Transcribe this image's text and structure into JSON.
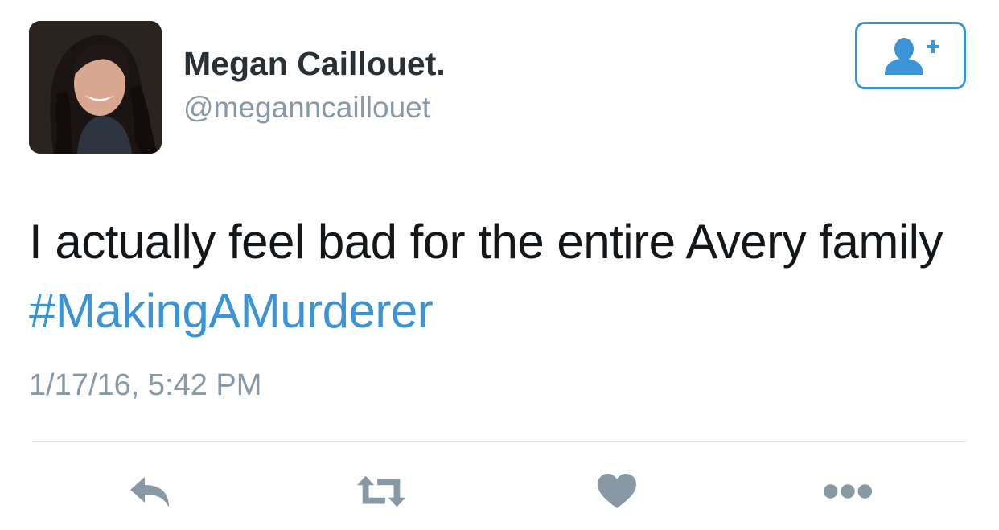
{
  "user": {
    "display_name": "Megan Caillouet.",
    "handle": "@meganncaillouet",
    "avatar": "profile-photo"
  },
  "follow_button": {
    "icon": "add-user-icon",
    "color": "#3a94d6"
  },
  "tweet": {
    "text": "I actually feel bad for the entire Avery family",
    "hashtag": "#MakingAMurderer",
    "hashtag_color": "#3a94d6",
    "timestamp": "1/17/16, 5:42 PM"
  },
  "actions": [
    {
      "name": "reply",
      "icon": "reply-icon"
    },
    {
      "name": "retweet",
      "icon": "retweet-icon"
    },
    {
      "name": "like",
      "icon": "heart-icon"
    },
    {
      "name": "more",
      "icon": "more-icon"
    }
  ],
  "colors": {
    "muted": "#8899a6",
    "text": "#14171a",
    "icon": "#8899a6"
  }
}
